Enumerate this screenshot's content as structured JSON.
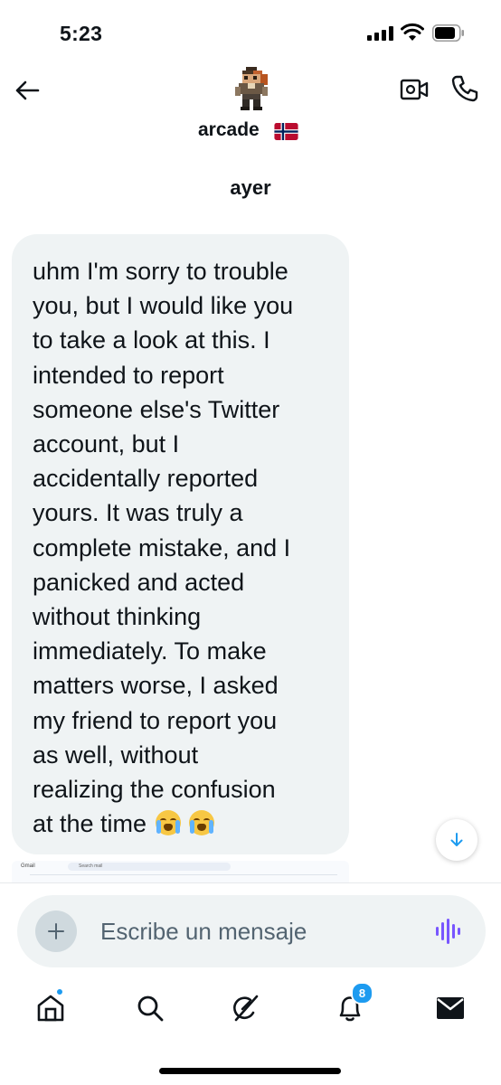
{
  "status_bar": {
    "time": "5:23"
  },
  "header": {
    "contact_name": "arcade",
    "flag": "norway-flag",
    "back_icon": "arrow-left-icon",
    "video_icon": "video-call-icon",
    "call_icon": "phone-icon"
  },
  "conversation": {
    "day_label": "ayer",
    "message_text": "uhm I'm sorry to trouble\nyou, but I would like you\nto take a look at this. I\nintended to report\nsomeone else's Twitter\naccount, but I\naccidentally reported\nyours. It was truly a\ncomplete mistake, and I\npanicked and acted\nwithout thinking\nimmediately. To make\nmatters worse, I asked\nmy friend to report you\nas well, without\nrealizing the confusion\nat the time ",
    "message_emojis": [
      "loudly-crying-face",
      "loudly-crying-face"
    ],
    "attachment_preview": {
      "app_label": "Gmail",
      "search_placeholder": "Search mail"
    }
  },
  "composer": {
    "placeholder": "Escribe un mensaje",
    "add_icon": "plus-icon",
    "voice_icon": "voice-waveform-icon"
  },
  "bottom_nav": {
    "items": [
      "home-icon",
      "search-icon",
      "grok-icon",
      "notifications-icon",
      "messages-icon"
    ],
    "notification_count": "8"
  },
  "colors": {
    "accent": "#1d9bf0",
    "bubble_bg": "#eff3f4",
    "voice_accent": "#7856ff"
  }
}
